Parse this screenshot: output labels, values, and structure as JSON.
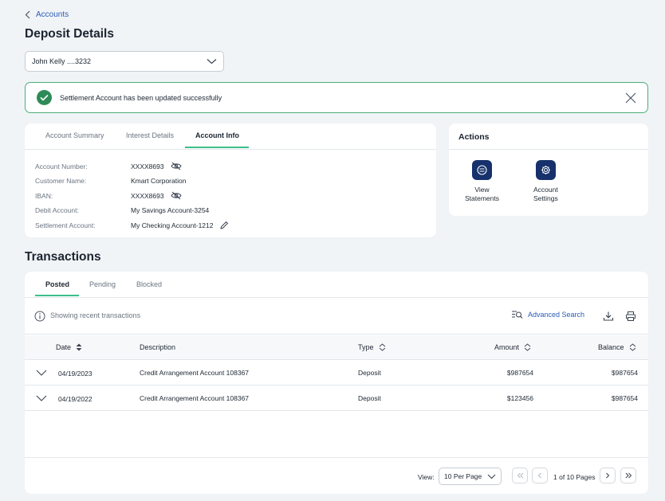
{
  "breadcrumb": {
    "label": "Accounts"
  },
  "page": {
    "title": "Deposit Details"
  },
  "account_select": {
    "value": "John Kelly ....3232"
  },
  "alert": {
    "message": "Settlement Account has been updated successfully"
  },
  "info_tabs": {
    "items": [
      {
        "label": "Account Summary"
      },
      {
        "label": "Interest Details"
      },
      {
        "label": "Account Info"
      }
    ],
    "active": "Account Info"
  },
  "account_info": {
    "rows": [
      {
        "label": "Account Number:",
        "value": "XXXX8693"
      },
      {
        "label": "Customer Name:",
        "value": "Kmart Corporation"
      },
      {
        "label": "IBAN:",
        "value": "XXXX8693"
      },
      {
        "label": "Debit Account:",
        "value": "My Savings Account-3254"
      },
      {
        "label": "Settlement Account:",
        "value": "My Checking Account-1212"
      }
    ]
  },
  "actions": {
    "title": "Actions",
    "items": [
      {
        "line1": "View",
        "line2": "Statements"
      },
      {
        "line1": "Account",
        "line2": "Settings"
      }
    ]
  },
  "transactions": {
    "title": "Transactions",
    "tabs": [
      {
        "label": "Posted"
      },
      {
        "label": "Pending"
      },
      {
        "label": "Blocked"
      }
    ],
    "active_tab": "Posted",
    "info_text": "Showing recent transactions",
    "advanced_search": "Advanced Search",
    "columns": {
      "date": "Date",
      "description": "Description",
      "type": "Type",
      "amount": "Amount",
      "balance": "Balance"
    },
    "rows": [
      {
        "date": "04/19/2023",
        "description": "Credit Arrangement Account 108367",
        "type": "Deposit",
        "amount": "$987654",
        "balance": "$987654"
      },
      {
        "date": "04/19/2022",
        "description": "Credit Arrangement Account 108367",
        "type": "Deposit",
        "amount": "$123456",
        "balance": "$987654"
      }
    ],
    "footer": {
      "view_label": "View:",
      "per_page": "10 Per Page",
      "page_text": "1 of 10 Pages"
    }
  },
  "colors": {
    "accent": "#3bbf8a",
    "primary_dark": "#16316b",
    "link": "#2a5cb8",
    "success": "#2e8b57"
  }
}
